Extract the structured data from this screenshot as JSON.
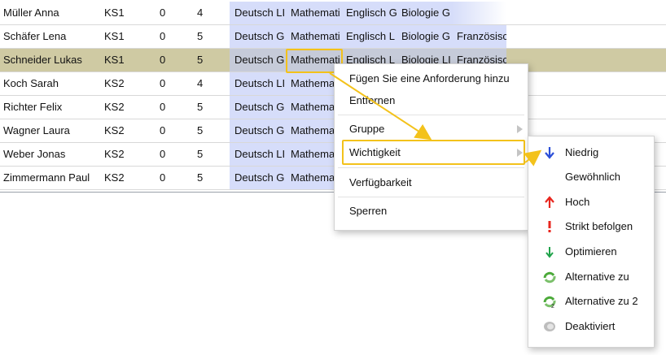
{
  "rows": [
    {
      "name": "Müller Anna",
      "class": "KS1",
      "n1": "0",
      "n2": "4",
      "s1": "Deutsch LI",
      "s2": "Mathemati",
      "s3": "Englisch G",
      "s4": "Biologie G",
      "s5": ""
    },
    {
      "name": "Schäfer Lena",
      "class": "KS1",
      "n1": "0",
      "n2": "5",
      "s1": "Deutsch G",
      "s2": "Mathemati",
      "s3": "Englisch L",
      "s4": "Biologie G",
      "s5": "Französisc"
    },
    {
      "name": "Schneider Lukas",
      "class": "KS1",
      "n1": "0",
      "n2": "5",
      "s1": "Deutsch G",
      "s2": "Mathemati",
      "s3": "Englisch L",
      "s4": "Biologie LI",
      "s5": "Französisc"
    },
    {
      "name": "Koch Sarah",
      "class": "KS2",
      "n1": "0",
      "n2": "4",
      "s1": "Deutsch LI",
      "s2": "Mathema",
      "s3": "",
      "s4": "",
      "s5": ""
    },
    {
      "name": "Richter Felix",
      "class": "KS2",
      "n1": "0",
      "n2": "5",
      "s1": "Deutsch G",
      "s2": "Mathema",
      "s3": "",
      "s4": "",
      "s5": ""
    },
    {
      "name": "Wagner Laura",
      "class": "KS2",
      "n1": "0",
      "n2": "5",
      "s1": "Deutsch G",
      "s2": "Mathema",
      "s3": "",
      "s4": "",
      "s5": ""
    },
    {
      "name": "Weber Jonas",
      "class": "KS2",
      "n1": "0",
      "n2": "5",
      "s1": "Deutsch LI",
      "s2": "Mathema",
      "s3": "",
      "s4": "",
      "s5": ""
    },
    {
      "name": "Zimmermann Paul",
      "class": "KS2",
      "n1": "0",
      "n2": "5",
      "s1": "Deutsch G",
      "s2": "Mathema",
      "s3": "",
      "s4": "",
      "s5": ""
    }
  ],
  "context_menu": {
    "add": "Fügen Sie eine Anforderung hinzu",
    "remove": "Entfernen",
    "group": "Gruppe",
    "importance": "Wichtigkeit",
    "availability": "Verfügbarkeit",
    "lock": "Sperren"
  },
  "importance_menu": {
    "low": "Niedrig",
    "normal": "Gewöhnlich",
    "high": "Hoch",
    "strict": "Strikt befolgen",
    "optimize": "Optimieren",
    "alt1": "Alternative zu",
    "alt2": "Alternative zu 2",
    "disabled": "Deaktiviert"
  },
  "icons": {
    "low": "arrow-down-blue-icon",
    "high": "arrow-up-red-icon",
    "strict": "exclamation-red-icon",
    "optimize": "arrow-down-green-icon",
    "alt1": "alternative-icon",
    "alt2": "alternative-2-icon",
    "disabled": "disabled-icon"
  },
  "colors": {
    "selected_row": "#cfcaa3",
    "subject_cell": "#d6ddfa",
    "highlight": "#f3c21b"
  }
}
